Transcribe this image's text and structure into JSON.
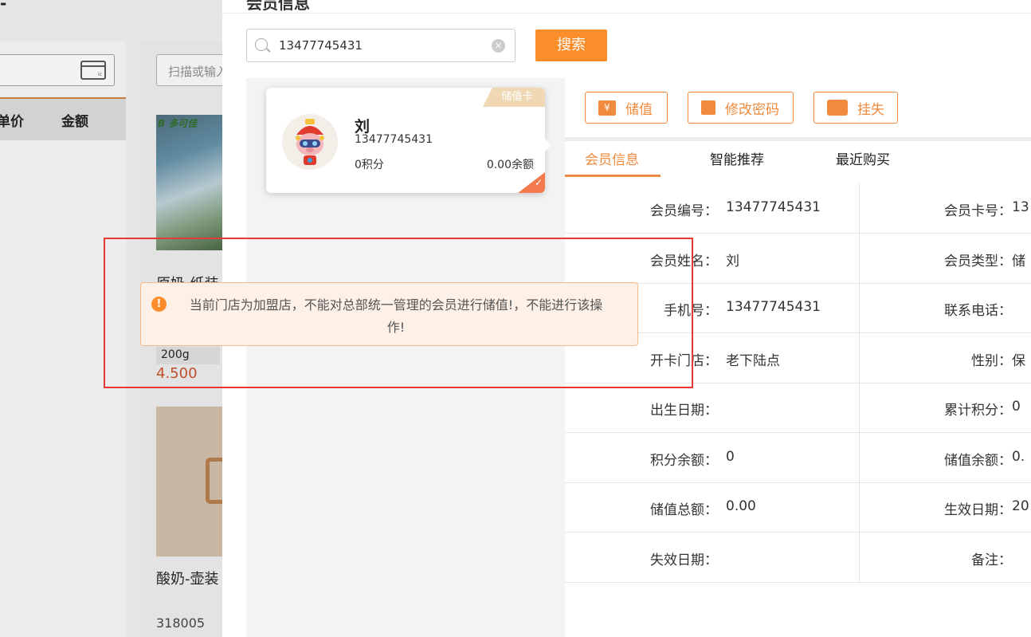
{
  "background": {
    "header_glyph": "-",
    "table_headers": [
      "单价",
      "金额"
    ],
    "scan_placeholder": "扫描或输入",
    "products": [
      {
        "logo": "B 多可佳",
        "name": "原奶-纸装",
        "spec": "200g",
        "price": "4.500"
      },
      {
        "name": "酸奶-壶装",
        "code": "318005"
      }
    ]
  },
  "panel": {
    "title": "会员信息",
    "search": {
      "value": "13477745431",
      "clear_glyph": "×"
    },
    "search_button": "搜索",
    "member_card": {
      "type_badge": "储值卡",
      "name": "刘",
      "phone": "13477745431",
      "points": "0积分",
      "balance": "0.00余额",
      "check_glyph": "✓"
    },
    "actions": [
      {
        "label": "储值",
        "icon": "yen-icon",
        "glyph": "¥"
      },
      {
        "label": "修改密码",
        "icon": "lock-icon",
        "glyph": "🔒"
      },
      {
        "label": "挂失",
        "icon": "card-icon",
        "glyph": ""
      }
    ],
    "tabs": [
      "会员信息",
      "智能推荐",
      "最近购买"
    ],
    "active_tab": "会员信息",
    "info_rows": [
      {
        "l_label": "会员编号：",
        "l_value": "13477745431",
        "r_label": "会员卡号：",
        "r_value": "13"
      },
      {
        "l_label": "会员姓名：",
        "l_value": "刘",
        "r_label": "会员类型：",
        "r_value": "储"
      },
      {
        "l_label": "手机号：",
        "l_value": "13477745431",
        "r_label": "联系电话：",
        "r_value": ""
      },
      {
        "l_label": "开卡门店：",
        "l_value": "老下陆点",
        "r_label": "性别：",
        "r_value": "保"
      },
      {
        "l_label": "出生日期：",
        "l_value": "",
        "r_label": "累计积分：",
        "r_value": "0"
      },
      {
        "l_label": "积分余额：",
        "l_value": "0",
        "r_label": "储值余额：",
        "r_value": "0."
      },
      {
        "l_label": "储值总额：",
        "l_value": "0.00",
        "r_label": "生效日期：",
        "r_value": "20"
      },
      {
        "l_label": "失效日期：",
        "l_value": "",
        "r_label": "备注：",
        "r_value": ""
      }
    ]
  },
  "toast": {
    "icon_glyph": "!",
    "message": "当前门店为加盟店，不能对总部统一管理的会员进行储值!，不能进行该操作!"
  },
  "colors": {
    "accent": "#fb8d2b",
    "highlight": "#e53935",
    "price": "#c0502a"
  }
}
